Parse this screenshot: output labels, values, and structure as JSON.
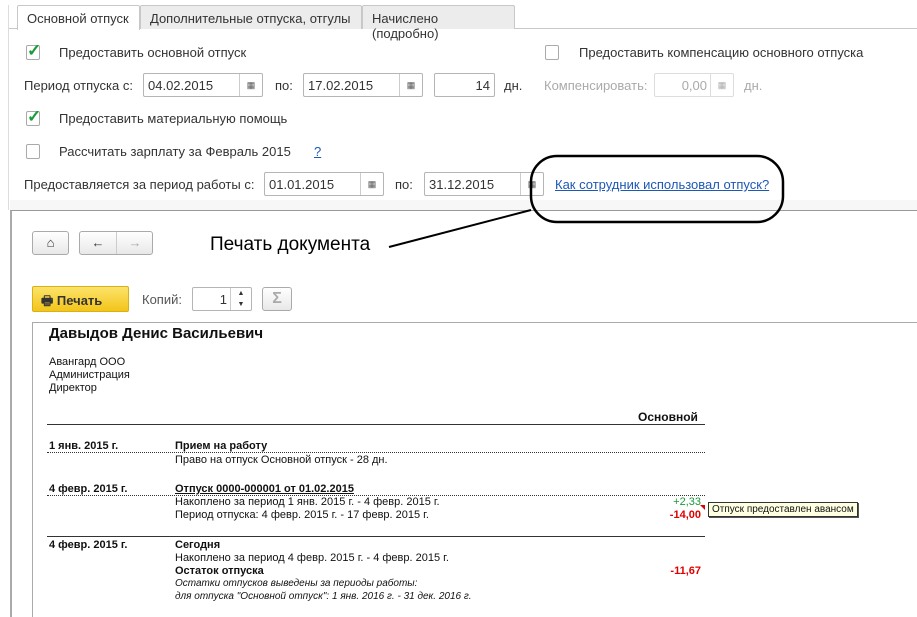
{
  "tabs": [
    {
      "label": "Основной отпуск",
      "active": true
    },
    {
      "label": "Дополнительные отпуска, отгулы"
    },
    {
      "label": "Начислено (подробно)"
    }
  ],
  "form": {
    "grant_main": {
      "label": "Предоставить основной отпуск",
      "checked": true
    },
    "grant_comp": {
      "label": "Предоставить компенсацию основного отпуска",
      "checked": false
    },
    "period_label": "Период отпуска с:",
    "period_from": "04.02.2015",
    "to_label": "по:",
    "period_to": "17.02.2015",
    "days": "14",
    "days_unit": "дн.",
    "compensate_label": "Компенсировать:",
    "compensate_value": "0,00",
    "compensate_unit": "дн.",
    "material_aid": {
      "label": "Предоставить материальную помощь",
      "checked": true
    },
    "calc_salary": {
      "label": "Рассчитать зарплату за Февраль 2015",
      "checked": false
    },
    "help_link": "?",
    "work_period_label": "Предоставляется за период работы с:",
    "work_from": "01.01.2015",
    "work_to_label": "по:",
    "work_to": "31.12.2015",
    "usage_link": "Как сотрудник использовал отпуск?"
  },
  "annotation": "Печать документа",
  "print": {
    "print_label": "Печать",
    "copies_label": "Копий:",
    "copies": "1",
    "sum_icon": "Σ"
  },
  "report": {
    "name": "Давыдов Денис Васильевич",
    "org": [
      "Авангард ООО",
      "Администрация",
      "Директор"
    ],
    "column": "Основной",
    "rows": [
      {
        "date": "1 янв. 2015 г.",
        "title": "Прием на работу",
        "lines": [
          "Право на отпуск Основной отпуск - 28 дн."
        ]
      },
      {
        "date": "4 февр. 2015 г.",
        "title": "Отпуск 0000-000001 от 01.02.2015",
        "lines": [
          "Накоплено за период 1 янв. 2015 г. - 4 февр. 2015 г.",
          "Период отпуска: 4 февр. 2015 г. - 17 февр. 2015 г."
        ],
        "values": [
          "+2,33",
          "-14,00"
        ],
        "tooltip": "Отпуск предоставлен авансом"
      },
      {
        "date": "4 февр. 2015 г.",
        "title": "Сегодня",
        "lines": [
          "Накоплено за период 4 февр. 2015 г. - 4 февр. 2015 г."
        ],
        "remainder_label": "Остаток отпуска",
        "remainder": "-11,67",
        "notes": [
          "Остатки отпусков выведены за периоды работы:",
          "для отпуска \"Основной отпуск\":  1 янв. 2016 г. - 31 дек. 2016 г."
        ]
      }
    ]
  },
  "colors": {
    "positive": "#1a9a3a",
    "negative": "#e00000",
    "link": "#1d58b5",
    "print_button": "#f5cc2a"
  }
}
